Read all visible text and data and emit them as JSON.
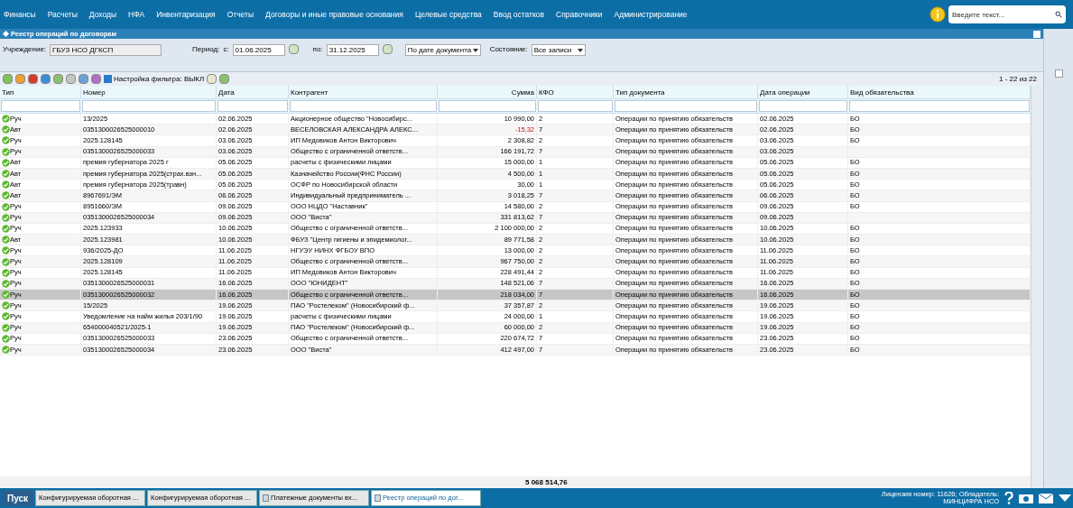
{
  "menu": [
    {
      "label": "Финансы"
    },
    {
      "label": "Расчеты"
    },
    {
      "label": "Доходы"
    },
    {
      "label": "НФА"
    },
    {
      "label": "Инвентаризация"
    },
    {
      "label": "Отчеты"
    },
    {
      "label": "Договоры и иные правовые основания"
    },
    {
      "label": "Целевые средства"
    },
    {
      "label": "Ввод остатков"
    },
    {
      "label": "Справочники"
    },
    {
      "label": "Администрирование"
    }
  ],
  "search": {
    "placeholder": "Введите текст..."
  },
  "window": {
    "title": "Реестр операций по договорам"
  },
  "filters": {
    "institution_label": "Учреждение:",
    "institution_value": "ГБУЗ НСО ДГКСП",
    "period_label": "Период:",
    "from_label": "с:",
    "from_value": "01.06.2025",
    "to_label": "по:",
    "to_value": "31.12.2025",
    "date_mode": "По дате документа",
    "state_label": "Состояние:",
    "state_value": "Все записи"
  },
  "toolbar": {
    "filter_button": "Настройка фильтра: ВЫКЛ",
    "pager": "1 - 22 из 22"
  },
  "table": {
    "columns": [
      "Тип",
      "Номер",
      "Дата",
      "Контрагент",
      "Сумма",
      "КФО",
      "Тип документа",
      "Дата операции",
      "Вид обязательства"
    ],
    "rows": [
      {
        "type": "Руч",
        "number": "13/2025",
        "date": "02.06.2025",
        "counterparty": "Акционерное общество \"Новосибирс...",
        "sum": "10 990,00",
        "kfo": "2",
        "doc_type": "Операции по принятию обязательств",
        "op_date": "02.06.2025",
        "obligation": "БО",
        "selected": false,
        "negative": false
      },
      {
        "type": "Авт",
        "number": "0351300026525000010",
        "date": "02.06.2025",
        "counterparty": "ВЕСЕЛОВСКАЯ АЛЕКСАНДРА АЛЕКС...",
        "sum": "-15,32",
        "kfo": "7",
        "doc_type": "Операции по принятию обязательств",
        "op_date": "02.06.2025",
        "obligation": "БО",
        "selected": false,
        "negative": true
      },
      {
        "type": "Руч",
        "number": "2025.128145",
        "date": "03.06.2025",
        "counterparty": "ИП Медовиков Антон Викторович",
        "sum": "2 308,82",
        "kfo": "2",
        "doc_type": "Операции по принятию обязательств",
        "op_date": "03.06.2025",
        "obligation": "БО",
        "selected": false,
        "negative": false
      },
      {
        "type": "Руч",
        "number": "0351300026525000033",
        "date": "03.06.2025",
        "counterparty": "Общество с ограниченной ответств...",
        "sum": "166 191,72",
        "kfo": "7",
        "doc_type": "Операции по принятию обязательств",
        "op_date": "03.06.2025",
        "selected": false,
        "negative": false
      },
      {
        "type": "Авт",
        "number": "премия губернатора 2025 г",
        "date": "05.06.2025",
        "counterparty": "расчеты с физическими лицами",
        "sum": "15 000,00",
        "kfo": "1",
        "doc_type": "Операции по принятию обязательств",
        "op_date": "05.06.2025",
        "obligation": "БО",
        "selected": false,
        "negative": false
      },
      {
        "type": "Авт",
        "number": "премия губернатора 2025(страх.взн...",
        "date": "05.06.2025",
        "counterparty": "Казначейство России(ФНС России)",
        "sum": "4 500,00",
        "kfo": "1",
        "doc_type": "Операции по принятию обязательств",
        "op_date": "05.06.2025",
        "obligation": "БО",
        "selected": false,
        "negative": false
      },
      {
        "type": "Авт",
        "number": "премия губернатора 2025(травн)",
        "date": "05.06.2025",
        "counterparty": "ОСФР по Новосибирской области",
        "sum": "30,00",
        "kfo": "1",
        "doc_type": "Операции по принятию обязательств",
        "op_date": "05.06.2025",
        "obligation": "БО",
        "selected": false,
        "negative": false
      },
      {
        "type": "Авт",
        "number": "8967691/ЭМ",
        "date": "06.06.2025",
        "counterparty": "Индивидуальный предприниматель ...",
        "sum": "3 018,25",
        "kfo": "7",
        "doc_type": "Операции по принятию обязательств",
        "op_date": "06.06.2025",
        "obligation": "БО",
        "selected": false,
        "negative": false
      },
      {
        "type": "Руч",
        "number": "8951660/ЭМ",
        "date": "09.06.2025",
        "counterparty": "ООО НЦДО \"Наставник\"",
        "sum": "14 580,00",
        "kfo": "2",
        "doc_type": "Операции по принятию обязательств",
        "op_date": "09.06.2025",
        "obligation": "БО",
        "selected": false,
        "negative": false
      },
      {
        "type": "Руч",
        "number": "0351300026525000034",
        "date": "09.06.2025",
        "counterparty": "ООО \"Виста\"",
        "sum": "331 813,62",
        "kfo": "7",
        "doc_type": "Операции по принятию обязательств",
        "op_date": "09.06.2025",
        "selected": false,
        "negative": false
      },
      {
        "type": "Руч",
        "number": "2025.123933",
        "date": "10.06.2025",
        "counterparty": "Общество с ограниченной ответств...",
        "sum": "2 100 000,00",
        "kfo": "2",
        "doc_type": "Операции по принятию обязательств",
        "op_date": "10.06.2025",
        "obligation": "БО",
        "selected": false,
        "negative": false
      },
      {
        "type": "Авт",
        "number": "2025.123981",
        "date": "10.06.2025",
        "counterparty": "ФБУЗ \"Центр гигиены и эпидемиолог...",
        "sum": "89 771,58",
        "kfo": "2",
        "doc_type": "Операции по принятию обязательств",
        "op_date": "10.06.2025",
        "obligation": "БО",
        "selected": false,
        "negative": false
      },
      {
        "type": "Руч",
        "number": "936/2025-ДО",
        "date": "11.06.2025",
        "counterparty": "НГУЭУ НИНХ ФГБОУ ВПО",
        "sum": "13 000,00",
        "kfo": "2",
        "doc_type": "Операции по принятию обязательств",
        "op_date": "11.06.2025",
        "obligation": "БО",
        "selected": false,
        "negative": false
      },
      {
        "type": "Руч",
        "number": "2025.128109",
        "date": "11.06.2025",
        "counterparty": "Общество с ограниченной ответств...",
        "sum": "967 750,00",
        "kfo": "2",
        "doc_type": "Операции по принятию обязательств",
        "op_date": "11.06.2025",
        "obligation": "БО",
        "selected": false,
        "negative": false
      },
      {
        "type": "Руч",
        "number": "2025.128145",
        "date": "11.06.2025",
        "counterparty": "ИП Медовиков Антон Викторович",
        "sum": "228 491,44",
        "kfo": "2",
        "doc_type": "Операции по принятию обязательств",
        "op_date": "11.06.2025",
        "obligation": "БО",
        "selected": false,
        "negative": false
      },
      {
        "type": "Руч",
        "number": "0351300026525000031",
        "date": "16.06.2025",
        "counterparty": "ООО \"ЮНИДЕНТ\"",
        "sum": "148 521,06",
        "kfo": "7",
        "doc_type": "Операции по принятию обязательств",
        "op_date": "16.06.2025",
        "obligation": "БО",
        "selected": false,
        "negative": false
      },
      {
        "type": "Руч",
        "number": "0351300026525000032",
        "date": "16.06.2025",
        "counterparty": "Общество с ограниченной ответств...",
        "sum": "218 034,00",
        "kfo": "7",
        "doc_type": "Операции по принятию обязательств",
        "op_date": "16.06.2025",
        "obligation": "БО",
        "selected": true,
        "negative": false
      },
      {
        "type": "Руч",
        "number": "15/2025",
        "date": "19.06.2025",
        "counterparty": "ПАО \"Ростелеком\" (Новосибирский ф...",
        "sum": "37 357,87",
        "kfo": "2",
        "doc_type": "Операции по принятию обязательств",
        "op_date": "19.06.2025",
        "obligation": "БО",
        "selected": false,
        "negative": false
      },
      {
        "type": "Руч",
        "number": "Уведомление на найм жилья 203/1/90",
        "date": "19.06.2025",
        "counterparty": "расчеты с физическими лицами",
        "sum": "24 000,00",
        "kfo": "1",
        "doc_type": "Операции по принятию обязательств",
        "op_date": "19.06.2025",
        "obligation": "БО",
        "selected": false,
        "negative": false
      },
      {
        "type": "Руч",
        "number": "654000040521/2025-1",
        "date": "19.06.2025",
        "counterparty": "ПАО \"Ростелеком\" (Новосибирский ф...",
        "sum": "60 000,00",
        "kfo": "2",
        "doc_type": "Операции по принятию обязательств",
        "op_date": "19.06.2025",
        "obligation": "БО",
        "selected": false,
        "negative": false
      },
      {
        "type": "Руч",
        "number": "0351300026525000033",
        "date": "23.06.2025",
        "counterparty": "Общество с ограниченной ответств...",
        "sum": "220 674,72",
        "kfo": "7",
        "doc_type": "Операции по принятию обязательств",
        "op_date": "23.06.2025",
        "obligation": "БО",
        "selected": false,
        "negative": false
      },
      {
        "type": "Руч",
        "number": "0351300026525000034",
        "date": "23.06.2025",
        "counterparty": "ООО \"Виста\"",
        "sum": "412 497,00",
        "kfo": "7",
        "doc_type": "Операции по принятию обязательств",
        "op_date": "23.06.2025",
        "obligation": "БО",
        "selected": false,
        "negative": false
      }
    ],
    "total": "5 068 514,76"
  },
  "taskbar": {
    "start": "Пуск",
    "tasks": [
      {
        "label": "Конфигурируемая оборотная ...",
        "selected": false,
        "icon": false
      },
      {
        "label": "Конфигурируемая оборотная ...",
        "selected": false,
        "icon": false
      },
      {
        "label": "Платежные документы вх...",
        "selected": false,
        "icon": true
      },
      {
        "label": "Реестр операций по дог...",
        "selected": true,
        "icon": true
      }
    ],
    "license": "Лицензия номер: 11626; Обладатель:",
    "license_owner": "МИНЦИФРА НСО"
  }
}
